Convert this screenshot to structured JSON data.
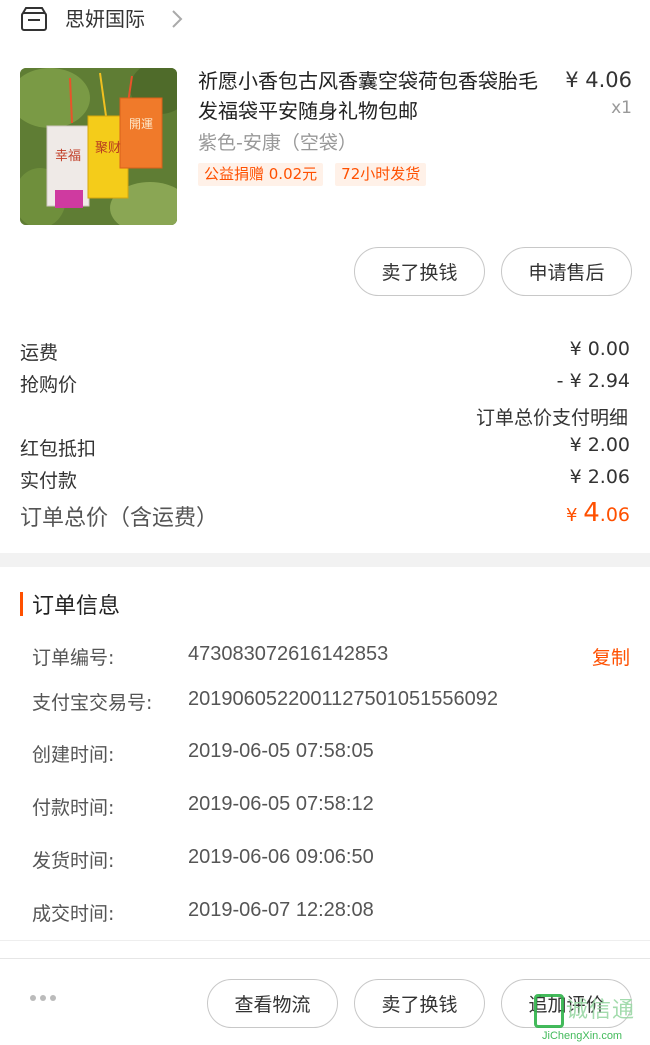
{
  "shop": {
    "name": "思妍国际"
  },
  "product": {
    "title": "祈愿小香包古风香囊空袋荷包香袋胎毛发福袋平安随身礼物包邮",
    "price": "¥ 4.06",
    "quantity": "x1",
    "sku": "紫色-安康（空袋）",
    "tags": [
      "公益捐赠 0.02元",
      "72小时发货"
    ],
    "image_characters": [
      "幸福",
      "聚财",
      "開運"
    ]
  },
  "item_actions": {
    "sell_label": "卖了换钱",
    "after_sale_label": "申请售后"
  },
  "fees": {
    "shipping_label": "运费",
    "shipping_value": "¥ 0.00",
    "flash_label": "抢购价",
    "flash_value": "- ¥ 2.94",
    "detail_link": "订单总价支付明细",
    "redpacket_label": "红包抵扣",
    "redpacket_value": "¥ 2.00",
    "paid_label": "实付款",
    "paid_value": "¥ 2.06",
    "total_label": "订单总价（含运费）",
    "total_currency": "¥ ",
    "total_int": "4",
    "total_dec": ".06"
  },
  "order_info": {
    "title": "订单信息",
    "copy_label": "复制",
    "rows": [
      {
        "label": "订单编号:",
        "value": "473083072616142853"
      },
      {
        "label": "支付宝交易号:",
        "value": "2019060522001127501051556092"
      },
      {
        "label": "创建时间:",
        "value": "2019-06-05 07:58:05"
      },
      {
        "label": "付款时间:",
        "value": "2019-06-05 07:58:12"
      },
      {
        "label": "发货时间:",
        "value": "2019-06-06 09:06:50"
      },
      {
        "label": "成交时间:",
        "value": "2019-06-07 12:28:08"
      }
    ]
  },
  "bottom_actions": {
    "logistics_label": "查看物流",
    "sell_label": "卖了换钱",
    "review_label": "追加评价"
  },
  "watermark": {
    "text": "诚信通",
    "sub": "JiChengXin.com"
  },
  "colors": {
    "accent": "#ff5000",
    "tag_bg": "#fff1e8",
    "muted": "#999999"
  }
}
